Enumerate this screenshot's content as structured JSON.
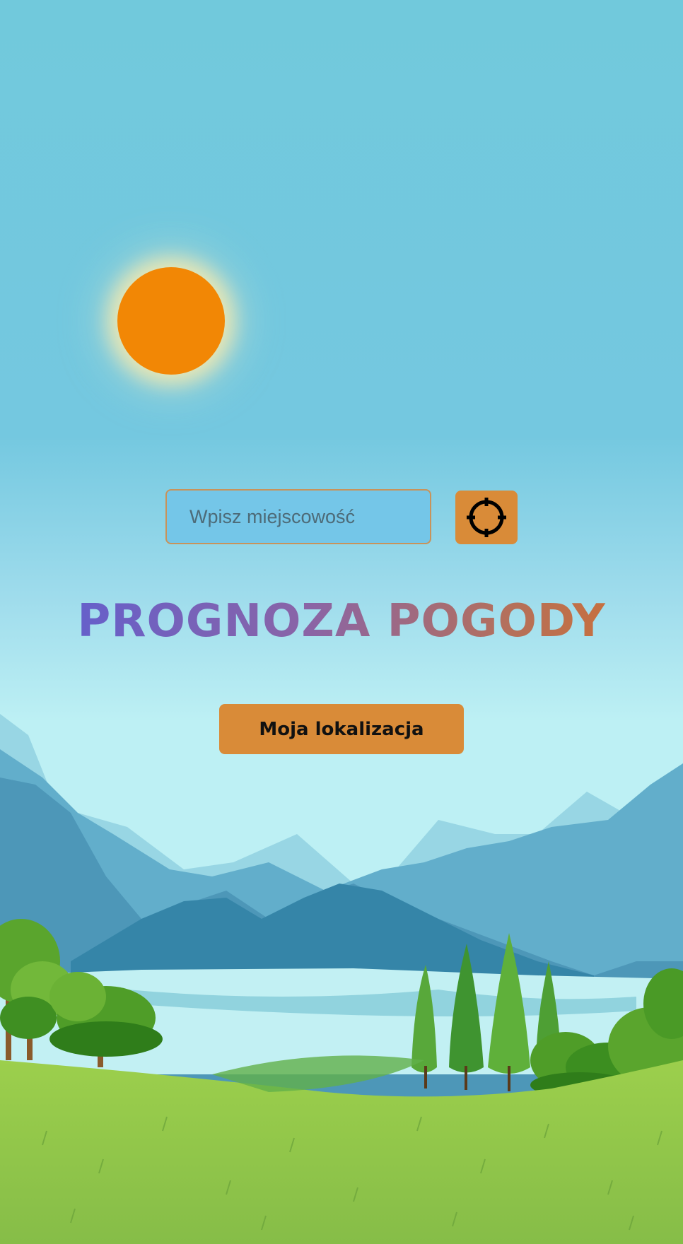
{
  "search": {
    "placeholder": "Wpisz miejscowość",
    "value": ""
  },
  "locate_button": {
    "icon": "crosshair-icon"
  },
  "header": {
    "title": "PROGNOZA POGODY"
  },
  "actions": {
    "my_location_label": "Moja lokalizacja"
  },
  "colors": {
    "accent": "#d98b38",
    "sun": "#f28705",
    "sky": "#71c9dc",
    "grass": "#8dc64a"
  }
}
